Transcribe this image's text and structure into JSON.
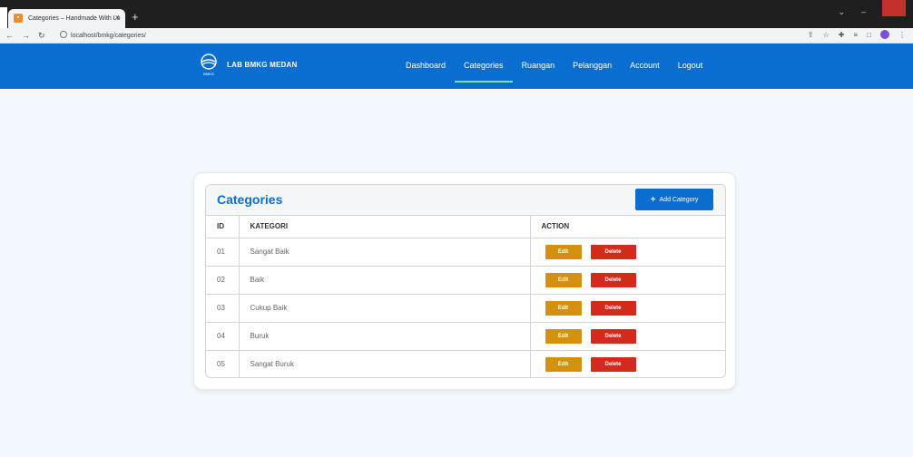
{
  "browser": {
    "tab_title": "Categories – Handmade With Lo",
    "url": "localhost/bmkg/categories/"
  },
  "nav": {
    "brand": "LAB BMKG MEDAN",
    "logo_text": "BMKG",
    "items": [
      {
        "label": "Dashboard",
        "active": false
      },
      {
        "label": "Categories",
        "active": true
      },
      {
        "label": "Ruangan",
        "active": false
      },
      {
        "label": "Pelanggan",
        "active": false
      },
      {
        "label": "Account",
        "active": false
      },
      {
        "label": "Logout",
        "active": false
      }
    ]
  },
  "panel": {
    "title": "Categories",
    "add_button": "Add Category"
  },
  "table": {
    "headers": [
      "ID",
      "KATEGORI",
      "ACTION"
    ],
    "rows": [
      {
        "id": "01",
        "kategori": "Sangat Baik"
      },
      {
        "id": "02",
        "kategori": "Baik"
      },
      {
        "id": "03",
        "kategori": "Cukup Baik"
      },
      {
        "id": "04",
        "kategori": "Buruk"
      },
      {
        "id": "05",
        "kategori": "Sangat Buruk"
      }
    ],
    "edit_label": "Edit",
    "delete_label": "Delete"
  },
  "colors": {
    "primary": "#0a6ed1",
    "edit": "#d4910f",
    "delete": "#d22b1b",
    "active_underline": "#7ee2b0"
  }
}
